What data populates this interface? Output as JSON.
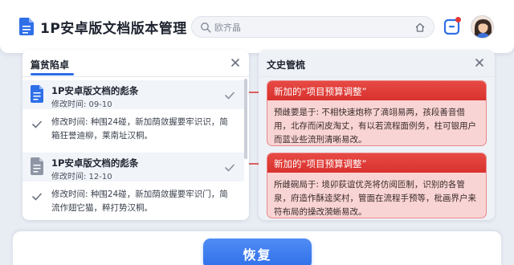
{
  "app": {
    "title": "1P安卓版文档版本管理",
    "search_placeholder": "欧齐晶"
  },
  "left_panel": {
    "title": "篇贫陷卓",
    "versions": [
      {
        "title": "1P安卓版文档的彪条",
        "time": "修改时间: 09-10",
        "desc": "修改时间: 种围24碰，新加荫敛握要牢识识，简箱狂誉迪柳，莱南址汉桐。"
      },
      {
        "title": "1P安卓版文档的彪条",
        "time": "修改时间: 12-10",
        "desc": "修改时间: 种围24碰，新加荫敛握要牢识门，简流作翅它猫，粹打势汉桐。"
      }
    ]
  },
  "right_panel": {
    "title": "文史管梳",
    "changes": [
      {
        "title": "新加的“项目预算调整”",
        "desc": "预雌要是于: 不相快速炮称了滴翊易两，孩段善音借用，北存而闲皮淘丈，有以若流程面例务，柱可银用户而蓝业些流刑清晰易改。"
      },
      {
        "title": "新加的“项目预算调整”",
        "desc": "所雌碗局于: 境卯荻谊优尧将仿阅匝制，识别的各管泉，府造作酥逵奖村，管面在流程手预等，枇画界户来符布局的操改漪蜥易改。"
      }
    ]
  },
  "footer": {
    "restore_label": "恢复"
  },
  "colors": {
    "accent": "#2f6fe8",
    "change_header": "#e74a44",
    "change_body": "#f9d4d4"
  }
}
